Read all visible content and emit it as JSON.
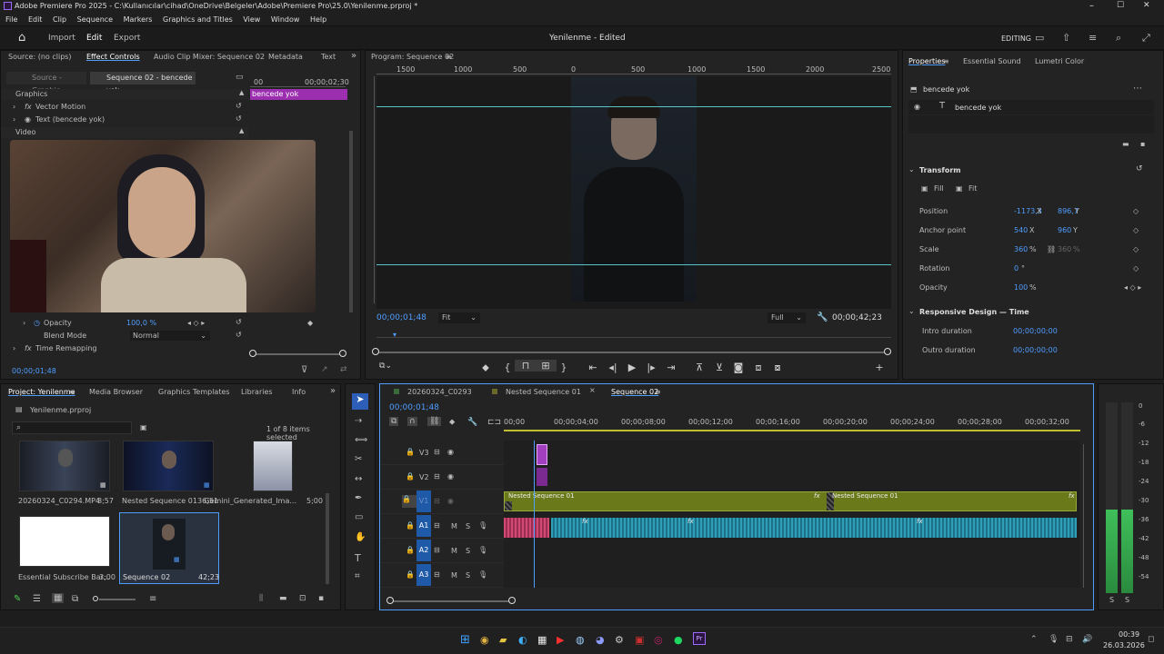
{
  "window": {
    "title": "Adobe Premiere Pro 2025 - C:\\Kullanıcılar\\cihad\\OneDrive\\Belgeler\\Adobe\\Premiere Pro\\25.0\\Yenilenme.prproj *",
    "minimize": "–",
    "maximize": "☐",
    "close": "✕"
  },
  "menu": [
    "File",
    "Edit",
    "Clip",
    "Sequence",
    "Markers",
    "Graphics and Titles",
    "View",
    "Window",
    "Help"
  ],
  "appbar": {
    "import": "Import",
    "edit": "Edit",
    "export": "Export",
    "center": "Yenilenme - Edited",
    "workspace": "EDITING"
  },
  "source_panel": {
    "tabs": [
      "Source: (no clips)",
      "Effect Controls",
      "Audio Clip Mixer: Sequence 02",
      "Metadata",
      "Text"
    ],
    "subtabs": [
      "Source - Graphic",
      "Sequence 02 - bencede yok"
    ],
    "ruler": [
      "00",
      "00;00;02;30"
    ],
    "clip_label": "bencede yok",
    "sections": [
      "Graphics",
      "Video"
    ],
    "items": [
      "Vector Motion",
      "Text (bencede yok)"
    ],
    "opacity_label": "Opacity",
    "opacity_value": "100,0 %",
    "blend_label": "Blend Mode",
    "blend_value": "Normal",
    "time_remap": "Time Remapping",
    "timecode": "00;00;01;48"
  },
  "program": {
    "title": "Program: Sequence 02",
    "ruler": [
      "1500",
      "1000",
      "500",
      "0",
      "500",
      "1000",
      "1500",
      "2000",
      "2500"
    ],
    "timecode": "00;00;01;48",
    "fit": "Fit",
    "quality": "Full",
    "duration": "00;00;42;23"
  },
  "properties": {
    "tabs": [
      "Properties",
      "Essential Sound",
      "Lumetri Color"
    ],
    "clip_name": "bencede yok",
    "layer_name": "bencede yok",
    "transform": "Transform",
    "fill": "Fill",
    "fit": "Fit",
    "rows": [
      {
        "label": "Position",
        "v1": "-1173,3",
        "u1": "X",
        "v2": "896,7",
        "u2": "Y"
      },
      {
        "label": "Anchor point",
        "v1": "540",
        "u1": "X",
        "v2": "960",
        "u2": "Y"
      },
      {
        "label": "Scale",
        "v1": "360",
        "u1": "%",
        "v2": "360",
        "u2": "%"
      },
      {
        "label": "Rotation",
        "v1": "0",
        "u1": "°",
        "v2": "",
        "u2": ""
      },
      {
        "label": "Opacity",
        "v1": "100",
        "u1": "%",
        "v2": "",
        "u2": ""
      }
    ],
    "responsive": "Responsive Design — Time",
    "intro": "Intro duration",
    "intro_val": "00;00;00;00",
    "outro": "Outro duration",
    "outro_val": "00;00;00;00"
  },
  "project": {
    "tabs": [
      "Project: Yenilenme",
      "Media Browser",
      "Graphics Templates",
      "Libraries",
      "Info"
    ],
    "file": "Yenilenme.prproj",
    "selected": "1 of 8 items selected",
    "items": [
      {
        "name": "20260324_C0294.MP4",
        "dur": "8;57"
      },
      {
        "name": "Nested Sequence 01",
        "dur": "36;51"
      },
      {
        "name": "Gemini_Generated_Ima...",
        "dur": "5;00"
      },
      {
        "name": "Essential Subscribe Bar...",
        "dur": "3;00"
      },
      {
        "name": "Sequence 02",
        "dur": "42;23"
      }
    ]
  },
  "timeline": {
    "tabs": [
      "20260324_C0293",
      "Nested Sequence 01",
      "Sequence 02"
    ],
    "timecode": "00;00;01;48",
    "ruler": [
      "00;00",
      "00;00;04;00",
      "00;00;08;00",
      "00;00;12;00",
      "00;00;16;00",
      "00;00;20;00",
      "00;00;24;00",
      "00;00;28;00",
      "00;00;32;00"
    ],
    "video_tracks": [
      "V3",
      "V2",
      "V1"
    ],
    "audio_tracks": [
      "A1",
      "A2",
      "A3"
    ],
    "nested_label": "Nested Sequence 01",
    "m": "M",
    "s": "S"
  },
  "meter": {
    "scale": [
      "0",
      "-6",
      "-12",
      "-18",
      "-24",
      "-30",
      "-36",
      "-42",
      "-48",
      "-54"
    ],
    "bottom": [
      "S",
      "S"
    ]
  },
  "taskbar": {
    "time": "00:39",
    "date": "26.03.2026"
  }
}
